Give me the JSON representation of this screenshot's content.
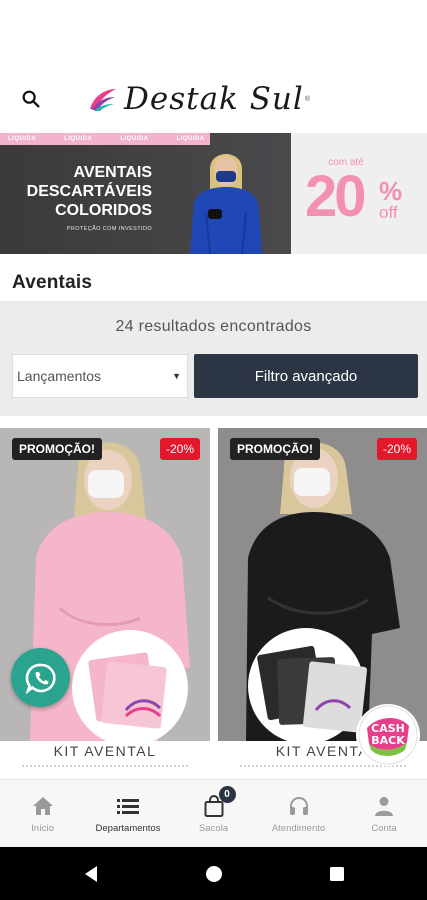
{
  "header": {
    "logo_text": "Destak Sul",
    "logo_reg": "®"
  },
  "banner": {
    "stripe_labels": [
      "LIQUIDA",
      "LIQUIDA",
      "LIQUIDA",
      "LIQUIDA"
    ],
    "title_lines": [
      "AVENTAIS",
      "DESCARTÁVEIS",
      "COLORIDOS"
    ],
    "subtitle": "PROTEÇÃO COM INVESTIDO",
    "promo_cc": "com até",
    "promo_value": "20",
    "promo_pct": "%",
    "promo_off": "off"
  },
  "category": {
    "title": "Aventais",
    "results_text": "24 resultados encontrados",
    "sort_selected": "Lançamentos",
    "filter_button": "Filtro avançado"
  },
  "products": [
    {
      "badge": "PROMOÇÃO!",
      "discount": "-20%",
      "name": "KIT AVENTAL",
      "color": "pink"
    },
    {
      "badge": "PROMOÇÃO!",
      "discount": "-20%",
      "name": "KIT AVENTA",
      "color": "black"
    }
  ],
  "cashback": {
    "line1": "CASH",
    "line2": "BACK"
  },
  "bottom_nav": {
    "items": [
      {
        "label": "Início",
        "icon": "home-icon"
      },
      {
        "label": "Departamentos",
        "icon": "list-icon"
      },
      {
        "label": "Sacola",
        "icon": "bag-icon"
      },
      {
        "label": "Atendimento",
        "icon": "headset-icon"
      },
      {
        "label": "Conta",
        "icon": "person-icon"
      }
    ],
    "cart_count": "0"
  },
  "colors": {
    "brand_dark": "#2c3544",
    "promo_pink": "#f28fb2",
    "discount_red": "#e3182b",
    "whatsapp_green": "#2aa48f"
  }
}
